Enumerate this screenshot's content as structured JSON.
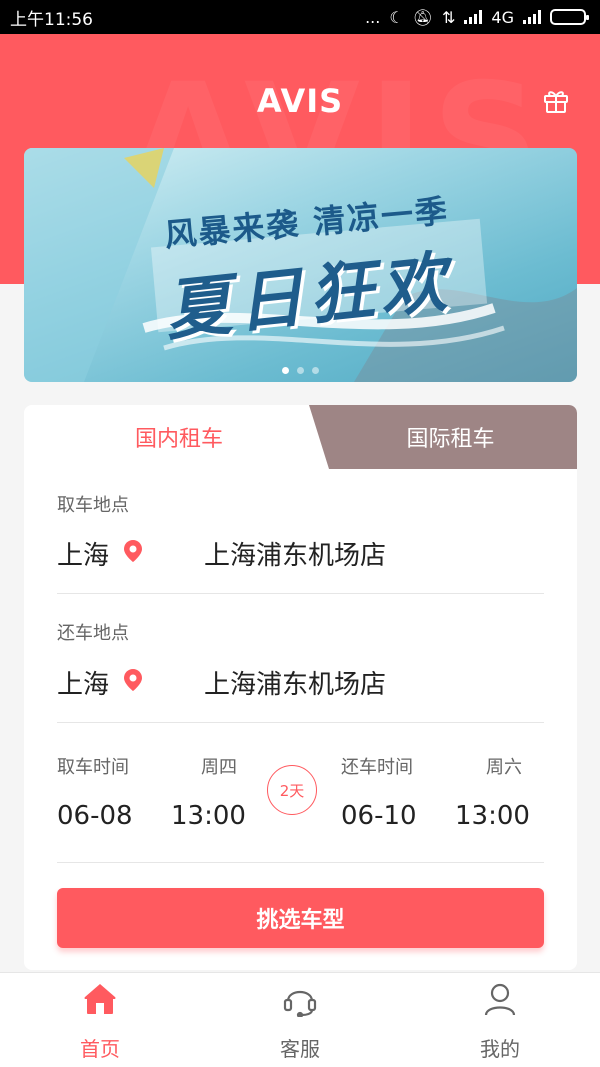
{
  "status_bar": {
    "time": "上午11:56",
    "network": "4G",
    "dots": "..."
  },
  "header": {
    "title": "AVIS",
    "watermark": "AVIS",
    "gift_icon": "gift-icon",
    "color": "#ff5a5f"
  },
  "banner": {
    "line1": "风暴来袭 清凉一季",
    "line2": "夏日狂欢",
    "slide_count": 3,
    "active_slide": 0
  },
  "booking": {
    "tabs": [
      {
        "label": "国内租车",
        "active": true
      },
      {
        "label": "国际租车",
        "active": false
      }
    ],
    "pickup": {
      "label": "取车地点",
      "city": "上海",
      "store": "上海浦东机场店"
    },
    "return": {
      "label": "还车地点",
      "city": "上海",
      "store": "上海浦东机场店"
    },
    "pickup_time": {
      "label": "取车时间",
      "weekday": "周四",
      "date": "06-08",
      "time": "13:00"
    },
    "return_time": {
      "label": "还车时间",
      "weekday": "周六",
      "date": "06-10",
      "time": "13:00"
    },
    "duration": "2天",
    "submit_label": "挑选车型"
  },
  "bottom_nav": [
    {
      "label": "首页",
      "icon": "home-icon",
      "active": true
    },
    {
      "label": "客服",
      "icon": "headset-icon",
      "active": false
    },
    {
      "label": "我的",
      "icon": "user-icon",
      "active": false
    }
  ]
}
